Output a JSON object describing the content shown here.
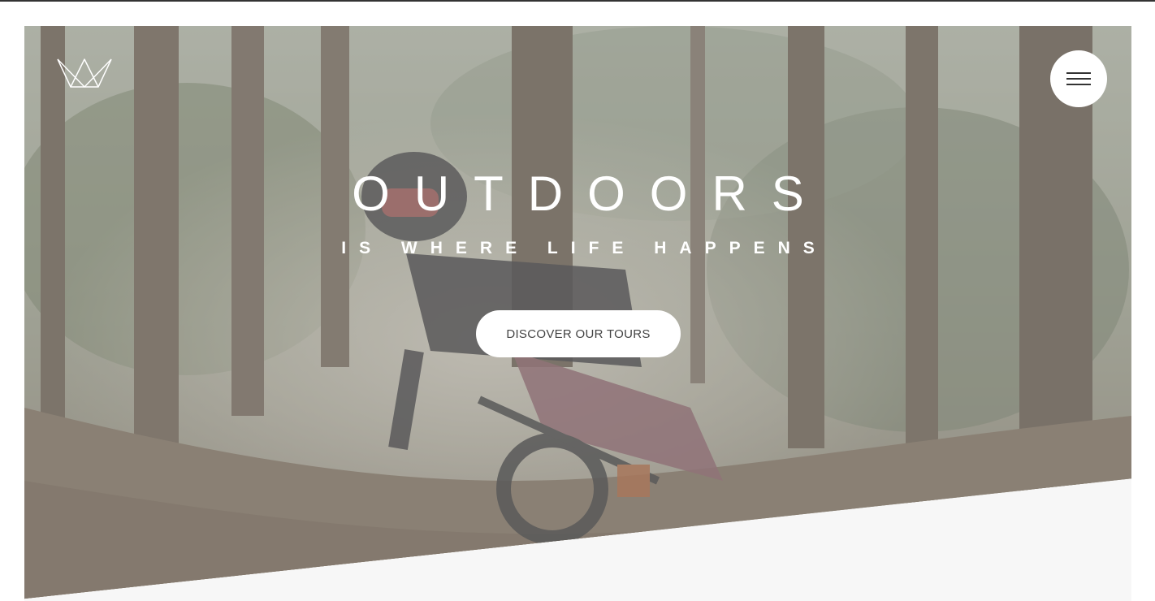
{
  "hero": {
    "title": "OUTDOORS",
    "subtitle": "IS WHERE LIFE HAPPENS",
    "cta_label": "DISCOVER OUR TOURS",
    "image_icon": "mountain-biker-forest-photo"
  },
  "header": {
    "logo_icon": "crown-logo-icon",
    "menu_icon": "hamburger-menu-icon"
  },
  "colors": {
    "background": "#ffffff",
    "section_below": "#f7f7f7",
    "button_bg": "#ffffff",
    "button_text": "#444444",
    "hero_text": "#ffffff"
  }
}
